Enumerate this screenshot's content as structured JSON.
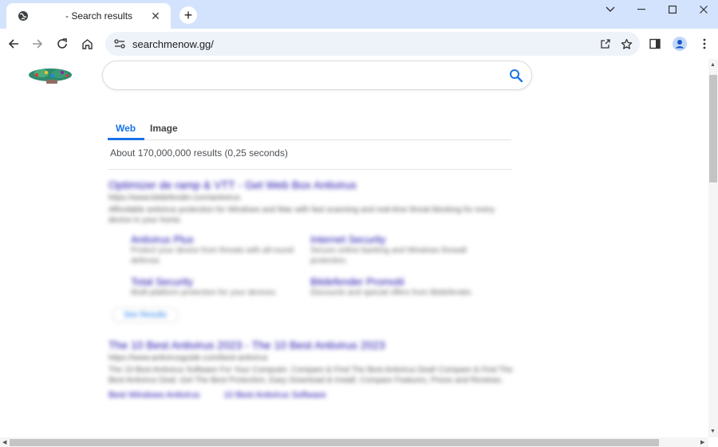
{
  "browser": {
    "tab": {
      "title": "- Search results",
      "favicon": "globe-icon"
    },
    "new_tab": "+",
    "window_controls": [
      "minimize-icon",
      "maximize-icon",
      "close-icon"
    ],
    "url": "searchmenow.gg/"
  },
  "search": {
    "query": "",
    "placeholder": ""
  },
  "tabs": [
    {
      "label": "Web",
      "active": true
    },
    {
      "label": "Image",
      "active": false
    }
  ],
  "stats": "About 170,000,000 results (0,25 seconds)",
  "results": [
    {
      "title": "Optimizer de ramp & VTT - Get Web Box Antivirus",
      "url": "https://www.bitdefender.com/antivirus",
      "snippet": "Affordable antivirus protection for Windows and Mac with fast scanning and real-time threat blocking for every device in your home.",
      "sublinks": [
        {
          "title": "Antivirus Plus",
          "desc": "Protect your device from threats with all-round defense."
        },
        {
          "title": "Internet Security",
          "desc": "Secure online banking and Windows firewall protection."
        },
        {
          "title": "Total Security",
          "desc": "Multi-platform protection for your devices."
        },
        {
          "title": "Bitdefender Promotii",
          "desc": "Discounts and special offers from Bitdefender."
        }
      ],
      "more": "See Results"
    },
    {
      "title": "The 10 Best Antivirus 2023 - The 10 Best Antivirus 2023",
      "url": "https://www.antivirusguide.com/best-antivirus",
      "snippet": "The 10 Best Antivirus Software For Your Computer. Compare & Find The Best Antivirus Deal! Compare & Find The Best Antivirus Deal. Get The Best Protection, Easy Download & Install. Compare Features, Prices and Reviews.",
      "links": [
        "Best Windows Antivirus",
        "10 Best Antivirus Software"
      ]
    }
  ],
  "colors": {
    "accent": "#1a73e8",
    "tabstrip": "#d3e3fd"
  }
}
